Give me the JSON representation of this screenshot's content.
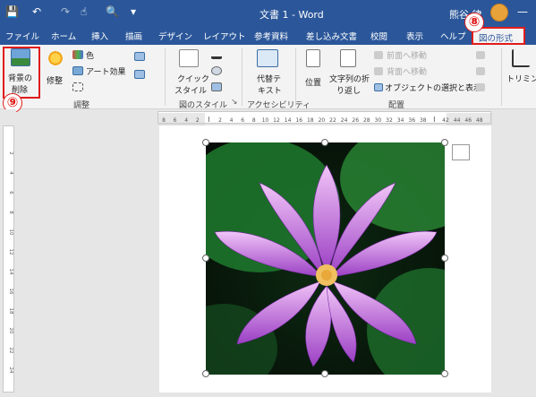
{
  "titlebar": {
    "title": "文書 1  -  Word",
    "user": "熊谷 律",
    "save_icon": "save-icon",
    "undo_icon": "undo-icon",
    "redo_icon": "redo-icon",
    "touch_icon": "touch-mode-icon",
    "preview_icon": "print-preview-icon",
    "more_icon": "customize-qat-icon",
    "min_icon": "minimize-icon",
    "qat_glyphs": [
      "💾",
      "↶",
      "↷",
      "☝",
      "🔍",
      "▾"
    ],
    "min_glyph": "—"
  },
  "tabs": [
    "ファイル",
    "ホーム",
    "挿入",
    "描画",
    "デザイン",
    "レイアウト",
    "参考資料",
    "差し込み文書",
    "校閲",
    "表示",
    "ヘルプ",
    "図の形式"
  ],
  "active_tab": "図の形式",
  "ribbon": {
    "remove_bg": [
      "背景の",
      "削除"
    ],
    "corrections": "修整",
    "color": "色",
    "artistic": "アート効果",
    "quick_style": [
      "クイック",
      "スタイル"
    ],
    "alt_text": [
      "代替テ",
      "キスト"
    ],
    "position": "位置",
    "wrap_text": [
      "文字列の折",
      "り返し"
    ],
    "bring_forward": "前面へ移動",
    "send_backward": "背面へ移動",
    "selection_pane": "オブジェクトの選択と表示",
    "trim": "トリミング",
    "dropdown_mark": "▾",
    "groups": {
      "adjust": "調整",
      "picture_styles": "図のスタイル",
      "accessibility": "アクセシビリティ",
      "arrange": "配置"
    }
  },
  "annotations": {
    "step8": "⑧",
    "step9": "⑨"
  },
  "ruler": {
    "labels": [
      "8",
      "6",
      "4",
      "2",
      "",
      "2",
      "4",
      "6",
      "8",
      "10",
      "12",
      "14",
      "16",
      "18",
      "20",
      "22",
      "24",
      "26",
      "28",
      "30",
      "32",
      "34",
      "36",
      "38",
      "",
      "42",
      "44",
      "46",
      "48"
    ],
    "vlabels": [
      "2",
      "4",
      "6",
      "8",
      "10",
      "12",
      "14",
      "16",
      "18",
      "20",
      "22",
      "24"
    ]
  },
  "image": {
    "subject": "lotus-flower",
    "colors": {
      "background": "#0a1a0c",
      "leaf": "#1f7a2e",
      "petal_light": "#e7a8f2",
      "petal_dark": "#9b3fc4",
      "center": "#f0c060"
    }
  },
  "colors": {
    "titlebar": "#2b579a",
    "ribbon": "#f3f3f3",
    "highlight": "#e01b1b",
    "canvas": "#e6e6e6"
  }
}
